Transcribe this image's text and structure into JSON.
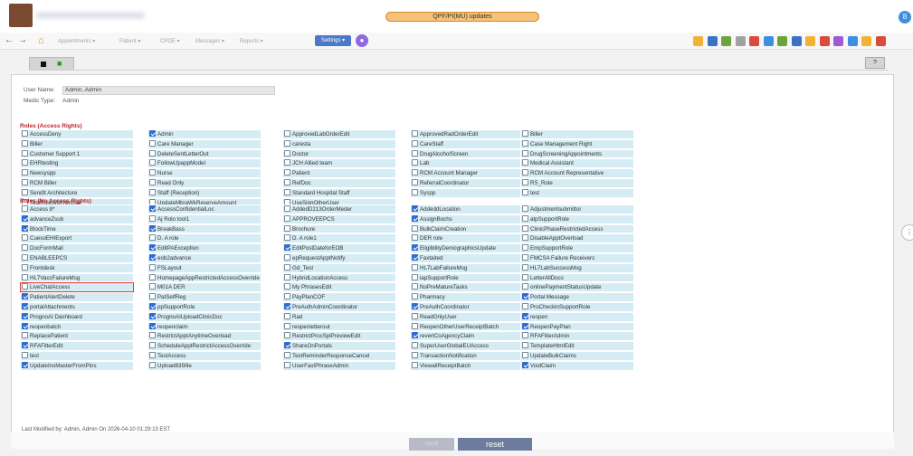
{
  "topbar": {
    "user_name": "",
    "center_text": "QPF/PI(MU) updates",
    "avatar_letter": "8"
  },
  "navbar": {
    "back_arrow": "←",
    "forward_arrow": "→",
    "home_icon": "⌂",
    "menus": [
      "Appointments ▾",
      "Patient ▾",
      "CPOE ▾",
      "Messages ▾",
      "Reports ▾"
    ],
    "settings_label": "Settings ▾",
    "chat_icon": "●",
    "toolbar_icon_colors": [
      "#f2b233",
      "#3a72c7",
      "#6ba43a",
      "#a1a1a1",
      "#d94c3c",
      "#3f8ee0",
      "#6ba43a",
      "#3a72c7",
      "#f2b233",
      "#d94c3c",
      "#a05ad6",
      "#3f8ee0",
      "#f2b233",
      "#d94c3c"
    ]
  },
  "subtoolbar": {
    "binoculars_icon": "■",
    "help_label": "?"
  },
  "info": {
    "username_label": "User Name:",
    "username_value": "Admin, Admin",
    "medic_type_label": "Medic Type:",
    "medic_type_value": "Admin"
  },
  "roles": {
    "access_rights_header": "Roles (Access Rights)",
    "no_access_header": "Roles (No Access Rights)",
    "access_rights": [
      {
        "label": "AccessDeny",
        "checked": false
      },
      {
        "label": "Admin",
        "checked": true
      },
      {
        "label": "ApprovedLabOrderEdit",
        "checked": false
      },
      {
        "label": "ApprovedRadOrderEdit",
        "checked": false
      },
      {
        "label": "Biller",
        "checked": false
      },
      {
        "label": "Biller",
        "checked": false
      },
      {
        "label": "Care Manager",
        "checked": false
      },
      {
        "label": "caresta",
        "checked": false
      },
      {
        "label": "CareStaff",
        "checked": false
      },
      {
        "label": "Case Management Right",
        "checked": false
      },
      {
        "label": "Customer Support 1",
        "checked": false
      },
      {
        "label": "DeleteSentLetterOut",
        "checked": false
      },
      {
        "label": "Doctor",
        "checked": false
      },
      {
        "label": "DrugAlcoholScreen",
        "checked": false
      },
      {
        "label": "DrugScreeningAppointments",
        "checked": false
      },
      {
        "label": "EHRtesting",
        "checked": false
      },
      {
        "label": "FollowUpappModel",
        "checked": false
      },
      {
        "label": "JCH Allied team",
        "checked": false
      },
      {
        "label": "Lab",
        "checked": false
      },
      {
        "label": "Medical Assistant",
        "checked": false
      },
      {
        "label": "Newsyspp",
        "checked": false
      },
      {
        "label": "Nurse",
        "checked": false
      },
      {
        "label": "Patient",
        "checked": false
      },
      {
        "label": "RCM Account Manager",
        "checked": false
      },
      {
        "label": "RCM Account Representative",
        "checked": false
      },
      {
        "label": "RCM Biller",
        "checked": false
      },
      {
        "label": "Read Only",
        "checked": false
      },
      {
        "label": "RefDoc",
        "checked": false
      },
      {
        "label": "ReferralCoordinator",
        "checked": false
      },
      {
        "label": "RS_Role",
        "checked": false
      },
      {
        "label": "SendIt Architecture",
        "checked": false
      },
      {
        "label": "Staff (Reception)",
        "checked": false
      },
      {
        "label": "Standard Hospital Staff",
        "checked": false
      },
      {
        "label": "Syspp",
        "checked": false
      },
      {
        "label": "test",
        "checked": false
      },
      {
        "label": "TestRoleWithNoUser",
        "checked": false
      },
      {
        "label": "UpdateMbraWkReserveAmount",
        "checked": false
      },
      {
        "label": "UseSignOtherUser",
        "checked": false
      }
    ],
    "no_access_rights": [
      {
        "label": "Access 8*",
        "checked": false
      },
      {
        "label": "AccessConfidentialLoc",
        "checked": true
      },
      {
        "label": "AddedD213OrderMeder",
        "checked": false
      },
      {
        "label": "AddeddLocation",
        "checked": true
      },
      {
        "label": "Adjustmentsubmittor",
        "checked": false
      },
      {
        "label": "advanceZsub",
        "checked": true
      },
      {
        "label": "Aj Rolo tool1",
        "checked": false
      },
      {
        "label": "APPROVEEPCS",
        "checked": false
      },
      {
        "label": "AssignBochs",
        "checked": true
      },
      {
        "label": "atpSupportRole",
        "checked": false
      },
      {
        "label": "BlockTime",
        "checked": true
      },
      {
        "label": "BreakBass",
        "checked": true
      },
      {
        "label": "Brochure",
        "checked": false
      },
      {
        "label": "BulkClaimCreation",
        "checked": false
      },
      {
        "label": "ClinicPhaseRestrictedAccess",
        "checked": false
      },
      {
        "label": "CuesoEHIExport",
        "checked": false
      },
      {
        "label": "D. A role",
        "checked": false
      },
      {
        "label": "D. A role1",
        "checked": false
      },
      {
        "label": "DER role",
        "checked": false
      },
      {
        "label": "DisableApptOverload",
        "checked": false
      },
      {
        "label": "DocFormMail",
        "checked": false
      },
      {
        "label": "EditPAException",
        "checked": true
      },
      {
        "label": "EditPostDateforEOB",
        "checked": true
      },
      {
        "label": "EligibilityDemographicsUpdate",
        "checked": true
      },
      {
        "label": "EmpSupportRole",
        "checked": false
      },
      {
        "label": "ENABLEEPCS",
        "checked": false
      },
      {
        "label": "eob2advance",
        "checked": true
      },
      {
        "label": "epRequestApptNotify",
        "checked": false
      },
      {
        "label": "Faxtaited",
        "checked": true
      },
      {
        "label": "FMCSA Failure Receivers",
        "checked": false
      },
      {
        "label": "Frontdesk",
        "checked": false
      },
      {
        "label": "FSLayout",
        "checked": false
      },
      {
        "label": "Gd_Test",
        "checked": false
      },
      {
        "label": "HL7LabFailureMsg",
        "checked": false
      },
      {
        "label": "HL7LabSuccessMsg",
        "checked": false
      },
      {
        "label": "HL7VaccFailureMsg",
        "checked": false
      },
      {
        "label": "HomepageAppRestrictedAccessOverride",
        "checked": false
      },
      {
        "label": "HybridLocationAccess",
        "checked": false
      },
      {
        "label": "iapSupportRole",
        "checked": false
      },
      {
        "label": "LetterAllDocs",
        "checked": false
      },
      {
        "label": "LiveChatAccess",
        "checked": false,
        "highlight": true
      },
      {
        "label": "M01A DER",
        "checked": false
      },
      {
        "label": "My PhrasesEdit",
        "checked": false
      },
      {
        "label": "NoPreMatureTasks",
        "checked": false
      },
      {
        "label": "onlinePaymentStatusUpdate",
        "checked": false
      },
      {
        "label": "PatientAlertDelete",
        "checked": true
      },
      {
        "label": "PatSelfReg",
        "checked": false
      },
      {
        "label": "PayPlanCOF",
        "checked": false
      },
      {
        "label": "Pharmacy",
        "checked": false
      },
      {
        "label": "Portal Message",
        "checked": true
      },
      {
        "label": "portalAttachments",
        "checked": true
      },
      {
        "label": "ppSupportRole",
        "checked": true
      },
      {
        "label": "PreAuthAdminCoordinator",
        "checked": true
      },
      {
        "label": "PreAuthCoordinator",
        "checked": true
      },
      {
        "label": "ProCheckinSupportRole",
        "checked": false
      },
      {
        "label": "PrognoAI Dashboard",
        "checked": true
      },
      {
        "label": "PrognoAIUploadClinicDoc",
        "checked": true
      },
      {
        "label": "Rad",
        "checked": false
      },
      {
        "label": "ReadOnlyUser",
        "checked": false
      },
      {
        "label": "reopen",
        "checked": true
      },
      {
        "label": "reopenbatch",
        "checked": true
      },
      {
        "label": "reopenclaim",
        "checked": true
      },
      {
        "label": "reopenletterout",
        "checked": false
      },
      {
        "label": "ReopenOtherUserReceiptBatch",
        "checked": false
      },
      {
        "label": "ReopenPayPlan",
        "checked": true
      },
      {
        "label": "ReplacePatient",
        "checked": false
      },
      {
        "label": "RestrictApptAnytimeOverload",
        "checked": false
      },
      {
        "label": "RestrictProcSplPreviewEdit",
        "checked": false
      },
      {
        "label": "revertCoAgencyClaim",
        "checked": true
      },
      {
        "label": "RFAFilterAdmin",
        "checked": false
      },
      {
        "label": "RFAFilterEdit",
        "checked": true
      },
      {
        "label": "ScheduleApptRestrictAccessOverride",
        "checked": false
      },
      {
        "label": "ShareOnPortals",
        "checked": true
      },
      {
        "label": "SuperUserGlobalEUAccess",
        "checked": false
      },
      {
        "label": "TemplateHtmlEdit",
        "checked": false
      },
      {
        "label": "test",
        "checked": false
      },
      {
        "label": "TestAccess",
        "checked": false
      },
      {
        "label": "TextReminderResponseCancel",
        "checked": false
      },
      {
        "label": "TransactionNotification",
        "checked": false
      },
      {
        "label": "UpdateBulkClaims",
        "checked": false
      },
      {
        "label": "UpdateInsMasterFromPins",
        "checked": true
      },
      {
        "label": "Upload835file",
        "checked": false
      },
      {
        "label": "UserFastPhraseAdmin",
        "checked": false
      },
      {
        "label": "ViewallReceiptBatch",
        "checked": false
      },
      {
        "label": "VoidClaim",
        "checked": true
      }
    ]
  },
  "footer": {
    "last_modified": "Last Modified by: Admin, Admin On 2026-04-10 01:29:13 EST",
    "save_label": "save",
    "reset_label": "reset"
  },
  "side_handle_icon": "⋮"
}
